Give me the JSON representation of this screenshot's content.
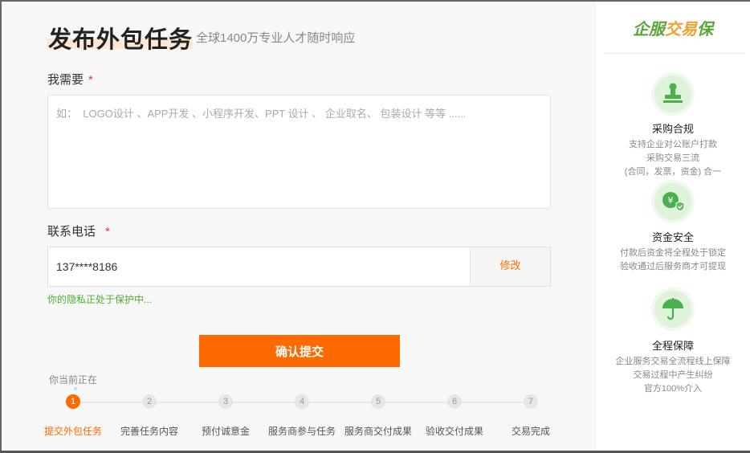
{
  "form": {
    "title": "发布外包任务",
    "subtitle": "全球1400万专业人才随时响应",
    "need_label": "我需要",
    "need_required": "*",
    "need_placeholder": "如：  LOGO设计 、APP开发 、小程序开发、PPT 设计 、 企业取名、 包装设计 等等 ......",
    "need_value": "",
    "phone_label": "联系电话",
    "phone_required": "*",
    "phone_value": "137****8186",
    "modify_label": "修改",
    "privacy_text": "你的隐私正处于保护中...",
    "submit_label": "确认提交"
  },
  "progress": {
    "current_label": "你当前正在",
    "current_step": 1,
    "steps": [
      {
        "num": "1",
        "label": "提交外包任务"
      },
      {
        "num": "2",
        "label": "完善任务内容"
      },
      {
        "num": "3",
        "label": "预付诚意金"
      },
      {
        "num": "4",
        "label": "服务商参与任务"
      },
      {
        "num": "5",
        "label": "服务商交付成果"
      },
      {
        "num": "6",
        "label": "验收交付成果"
      },
      {
        "num": "7",
        "label": "交易完成"
      }
    ]
  },
  "sidebar": {
    "brand_part1": "企服",
    "brand_part2": "交易",
    "brand_part3": "保",
    "features": [
      {
        "icon": "stamp-icon",
        "title": "采购合规",
        "desc": [
          "支持企业对公账户打款",
          "采购交易三流",
          "(合同，发票，资金) 合一"
        ]
      },
      {
        "icon": "yuan-shield-icon",
        "title": "资金安全",
        "desc": [
          "付款后资金将全程处于锁定",
          "验收通过后服务商才可提现"
        ]
      },
      {
        "icon": "umbrella-icon",
        "title": "全程保障",
        "desc": [
          "企业服务交易全流程线上保障",
          "交易过程中产生纠纷",
          "官方100%介入"
        ]
      }
    ]
  },
  "colors": {
    "accent": "#ff6a00",
    "green": "#5aa63a",
    "privacy": "#4caf32",
    "required": "#e4393c"
  }
}
